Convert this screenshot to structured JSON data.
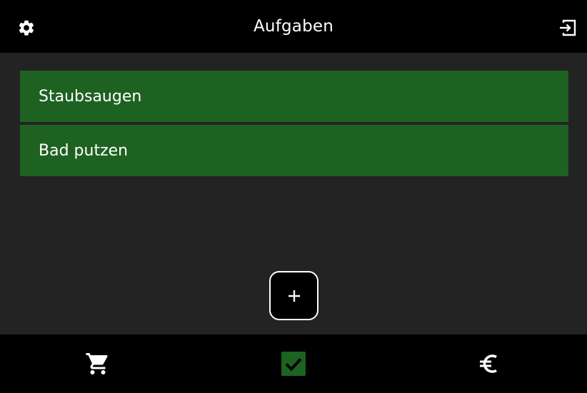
{
  "header": {
    "title": "Aufgaben",
    "left_icon": "gear-icon",
    "right_icon": "logout-icon"
  },
  "tasks": [
    {
      "label": "Staubsaugen"
    },
    {
      "label": "Bad putzen"
    }
  ],
  "add_button": {
    "icon": "plus-icon"
  },
  "bottom_nav": [
    {
      "icon": "shopping-cart-icon"
    },
    {
      "icon": "checkbox-checked-icon",
      "active": true
    },
    {
      "icon": "euro-icon"
    }
  ],
  "colors": {
    "background": "#232323",
    "bar": "#000000",
    "task": "#1e6222",
    "accent_green": "#1e6222",
    "text": "#ffffff"
  }
}
